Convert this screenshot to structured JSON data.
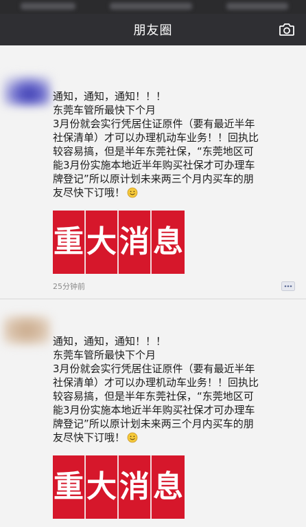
{
  "nav": {
    "title": "朋友圈",
    "camera_icon": "camera-icon"
  },
  "posts": [
    {
      "lines": [
        "通知，通知，通知！！！",
        "东莞车管所最快下个月",
        "3月份就会实行凭居住证原件（要有最近半年",
        "社保清单）才可以办理机动车业务！！回执比",
        "较容易搞，但是半年东莞社保，“东莞地区可",
        "能3月份实施本地近半年购买社保才可办理车",
        "牌登记”所以原计划未来两三个月内买车的朋",
        "友尽快下订哦！"
      ],
      "banner": [
        "重",
        "大",
        "消",
        "息"
      ],
      "time": "25分钟前",
      "emoji_icon": "smile-emoji-icon",
      "comment_icon": "comment-icon"
    },
    {
      "lines": [
        "通知，通知，通知！！！",
        "东莞车管所最快下个月",
        "3月份就会实行凭居住证原件（要有最近半年",
        "社保清单）才可以办理机动车业务！！回执比",
        "较容易搞，但是半年东莞社保，“东莞地区可",
        "能3月份实施本地近半年购买社保才可办理车",
        "牌登记”所以原计划未来两三个月内买车的朋",
        "友尽快下订哦！"
      ],
      "banner": [
        "重",
        "大",
        "消",
        "息"
      ],
      "emoji_icon": "smile-emoji-icon"
    }
  ],
  "colors": {
    "nav_bg": "#2f2f33",
    "banner_red": "#d6172b",
    "feed_bg": "#f3f3f3"
  }
}
